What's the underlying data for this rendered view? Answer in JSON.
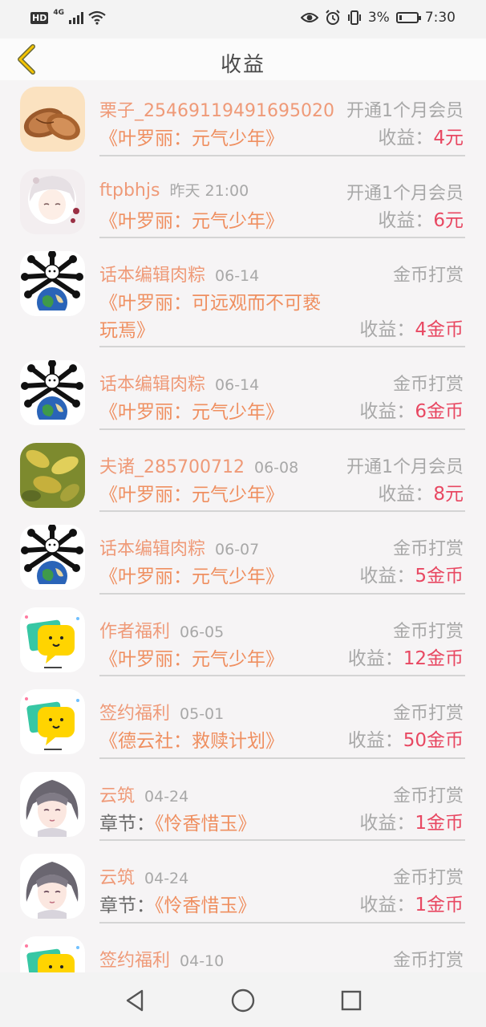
{
  "status_bar": {
    "hd": "HD",
    "network": "4G",
    "battery_percent": "3%",
    "time": "7:30"
  },
  "header": {
    "title": "收益",
    "back_icon": "chevron-left-icon"
  },
  "items": [
    {
      "avatar": "almond",
      "name": "栗子_25469119491695020",
      "date": "",
      "event": "开通1个月会员",
      "prefix": "",
      "book": "《叶罗丽：元气少年》",
      "earn_label": "收益：",
      "earn_value": "4元"
    },
    {
      "avatar": "anime-girl",
      "name": "ftpbhjs",
      "date": "昨天 21:00",
      "event": "开通1个月会员",
      "prefix": "",
      "book": "《叶罗丽：元气少年》",
      "earn_label": "收益：",
      "earn_value": "6元"
    },
    {
      "avatar": "globe-bones",
      "name": "话本编辑肉粽",
      "date": "06-14",
      "event": "金币打赏",
      "prefix": "",
      "book": "《叶罗丽：可远观而不可亵玩焉》",
      "earn_label": "收益：",
      "earn_value": "4金币"
    },
    {
      "avatar": "globe-bones",
      "name": "话本编辑肉粽",
      "date": "06-14",
      "event": "金币打赏",
      "prefix": "",
      "book": "《叶罗丽：元气少年》",
      "earn_label": "收益：",
      "earn_value": "6金币"
    },
    {
      "avatar": "leaves",
      "name": "夫诸_285700712",
      "date": "06-08",
      "event": "开通1个月会员",
      "prefix": "",
      "book": "《叶罗丽：元气少年》",
      "earn_label": "收益：",
      "earn_value": "8元"
    },
    {
      "avatar": "globe-bones",
      "name": "话本编辑肉粽",
      "date": "06-07",
      "event": "金币打赏",
      "prefix": "",
      "book": "《叶罗丽：元气少年》",
      "earn_label": "收益：",
      "earn_value": "5金币"
    },
    {
      "avatar": "chat-bubble",
      "name": "作者福利",
      "date": "06-05",
      "event": "金币打赏",
      "prefix": "",
      "book": "《叶罗丽：元气少年》",
      "earn_label": "收益：",
      "earn_value": "12金币"
    },
    {
      "avatar": "chat-bubble",
      "name": "签约福利",
      "date": "05-01",
      "event": "金币打赏",
      "prefix": "",
      "book": "《德云社：救赎计划》",
      "earn_label": "收益：",
      "earn_value": "50金币"
    },
    {
      "avatar": "anime-boy",
      "name": "云筑",
      "date": "04-24",
      "event": "金币打赏",
      "prefix": "章节：",
      "book": "《怜香惜玉》",
      "earn_label": "收益：",
      "earn_value": "1金币"
    },
    {
      "avatar": "anime-boy",
      "name": "云筑",
      "date": "04-24",
      "event": "金币打赏",
      "prefix": "章节：",
      "book": "《怜香惜玉》",
      "earn_label": "收益：",
      "earn_value": "1金币"
    },
    {
      "avatar": "chat-bubble",
      "name": "签约福利",
      "date": "04-10",
      "event": "金币打赏",
      "prefix": "",
      "book": "",
      "earn_label": "",
      "earn_value": ""
    }
  ],
  "nav_bar": {
    "back": "triangle-back-icon",
    "home": "circle-home-icon",
    "recents": "square-recents-icon"
  }
}
